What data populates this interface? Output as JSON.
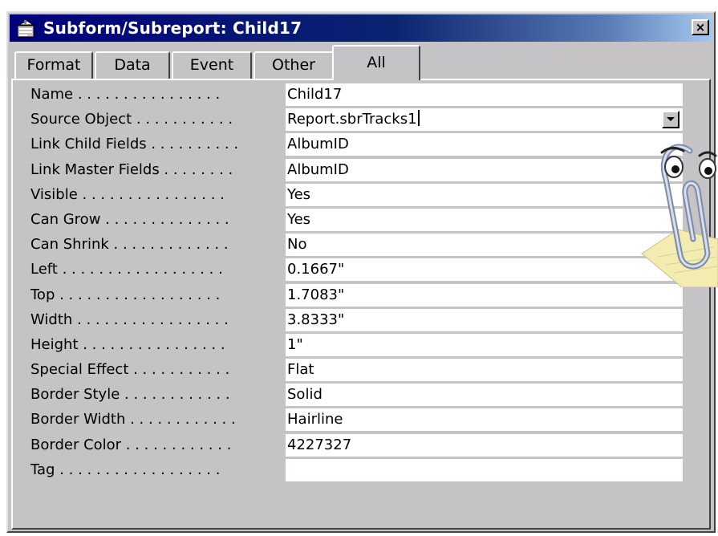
{
  "window": {
    "title": "Subform/Subreport: Child17",
    "close_glyph": "×",
    "icon": "properties-sheet-icon"
  },
  "tabs": [
    {
      "label": "Format",
      "active": false
    },
    {
      "label": "Data",
      "active": false
    },
    {
      "label": "Event",
      "active": false
    },
    {
      "label": "Other",
      "active": false
    },
    {
      "label": "All",
      "active": true
    }
  ],
  "properties": [
    {
      "label": "Name . . . . . . . . . . . . . . . .",
      "value": "Child17"
    },
    {
      "label": "Source Object . . . . . . . . . . .",
      "value": "Report.sbrTracks1",
      "dropdown": true,
      "focused": true
    },
    {
      "label": "Link Child Fields . . . . . . . . . .",
      "value": "AlbumID"
    },
    {
      "label": "Link Master Fields . . . . . . . .",
      "value": "AlbumID"
    },
    {
      "label": "Visible . . . . . . . . . . . . . . . .",
      "value": "Yes"
    },
    {
      "label": "Can Grow . . . . . . . . . . . . . .",
      "value": "Yes"
    },
    {
      "label": "Can Shrink . . . . . . . . . . . . .",
      "value": "No"
    },
    {
      "label": "Left . . . . . . . . . . . . . . . . . .",
      "value": "0.1667\""
    },
    {
      "label": "Top . . . . . . . . . . . . . . . . . .",
      "value": "1.7083\""
    },
    {
      "label": "Width . . . . . . . . . . . . . . . . .",
      "value": "3.8333\""
    },
    {
      "label": "Height . . . . . . . . . . . . . . . .",
      "value": "1\""
    },
    {
      "label": "Special Effect . . . . . . . . . . .",
      "value": "Flat"
    },
    {
      "label": "Border Style . . . . . . . . . . . .",
      "value": "Solid"
    },
    {
      "label": "Border Width . . . . . . . . . . . .",
      "value": "Hairline"
    },
    {
      "label": "Border Color . . . . . . . . . . . .",
      "value": "4227327"
    },
    {
      "label": "Tag . . . . . . . . . . . . . . . . . .",
      "value": ""
    }
  ],
  "colors": {
    "title_start": "#00007b",
    "title_end": "#a6caf0",
    "face": "#c6c3c6",
    "field": "#ffffff"
  },
  "assistant": {
    "icon": "office-assistant-paperclip-icon"
  }
}
